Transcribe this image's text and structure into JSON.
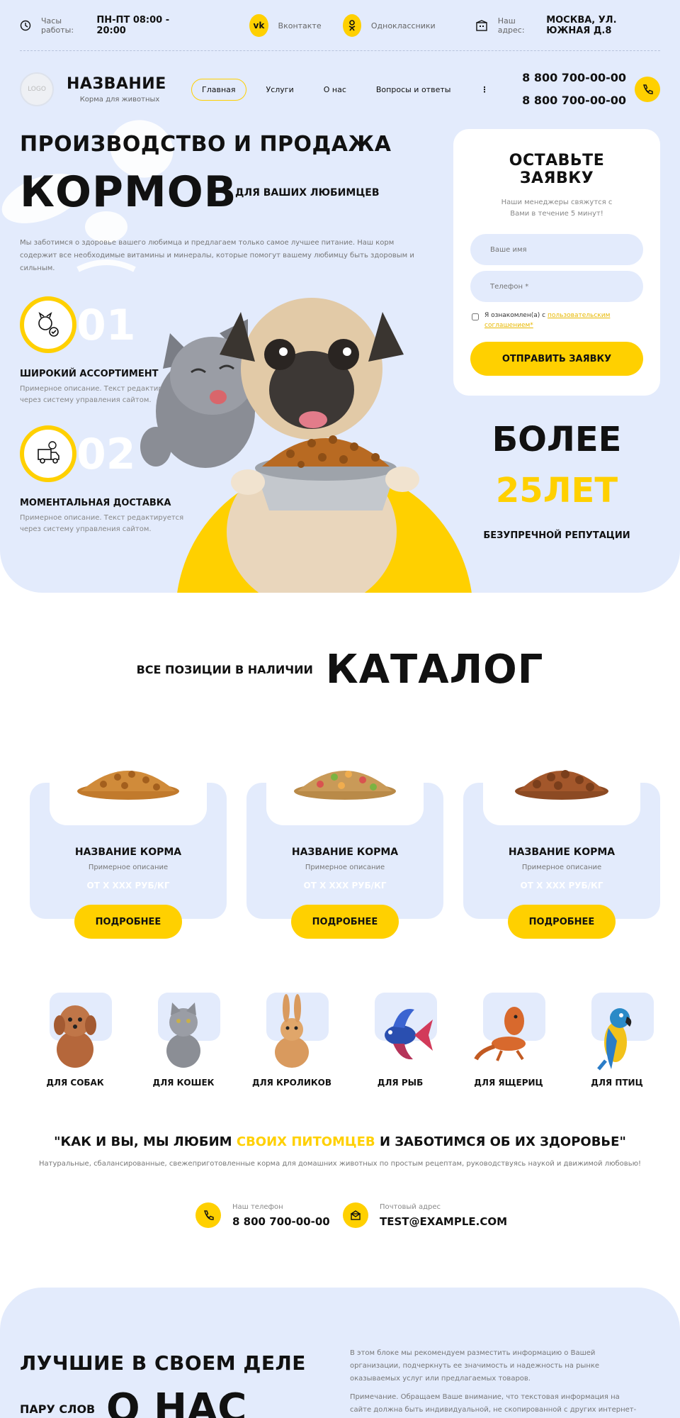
{
  "topbar": {
    "hours_label": "Часы работы:",
    "hours_value": "ПН-ПТ 08:00 - 20:00",
    "vk_icon": "vk",
    "vk_label": "Вконтакте",
    "ok_label": "Одноклассники",
    "address_label": "Наш адрес:",
    "address_value": "МОСКВА, УЛ. ЮЖНАЯ Д.8"
  },
  "header": {
    "logo_text": "LOGO",
    "brand_title": "НАЗВАНИЕ",
    "brand_subtitle": "Корма для животных",
    "nav": [
      "Главная",
      "Услуги",
      "О нас",
      "Вопросы и ответы"
    ],
    "more_icon": "⋮",
    "phone_1": "8 800 700-00-00",
    "phone_2": "8 800 700-00-00"
  },
  "hero": {
    "line1": "ПРОИЗВОДСТВО И ПРОДАЖА",
    "line2": "КОРМОВ",
    "line2_suffix": "ДЛЯ ВАШИХ ЛЮБИМЦЕВ",
    "description": "Мы заботимся о здоровье вашего любимца и предлагаем только самое лучшее питание. Наш корм содержит все необходимые витамины и минералы, которые помогут вашему любимцу быть здоровым и сильным.",
    "features": [
      {
        "num": "01",
        "title": "ШИРОКИЙ АССОРТИМЕНТ",
        "desc": "Примерное описание. Текст редактируется через систему управления сайтом."
      },
      {
        "num": "02",
        "title": "МОМЕНТАЛЬНАЯ ДОСТАВКА",
        "desc": "Примерное описание. Текст редактируется через систему управления сайтом."
      }
    ],
    "years_a": "БОЛЕЕ",
    "years_b": "25ЛЕТ",
    "years_c": "БЕЗУПРЕЧНОЙ РЕПУТАЦИИ"
  },
  "form": {
    "title": "ОСТАВЬТЕ ЗАЯВКУ",
    "subtitle": "Наши менеджеры свяжутся с Вами в течение 5 минут!",
    "name_placeholder": "Ваше имя",
    "phone_placeholder": "Телефон *",
    "consent_text": "Я ознакомлен(а) с",
    "consent_link": "пользовательским соглашением*",
    "submit": "ОТПРАВИТЬ ЗАЯВКУ"
  },
  "catalog": {
    "subtitle": "ВСЕ ПОЗИЦИИ В НАЛИЧИИ",
    "title": "КАТАЛОГ",
    "cards": [
      {
        "title": "НАЗВАНИЕ КОРМА",
        "desc": "Примерное описание",
        "price": "ОТ Х ХХХ РУБ/КГ",
        "button": "ПОДРОБНЕЕ"
      },
      {
        "title": "НАЗВАНИЕ КОРМА",
        "desc": "Примерное описание",
        "price": "ОТ Х ХХХ РУБ/КГ",
        "button": "ПОДРОБНЕЕ"
      },
      {
        "title": "НАЗВАНИЕ КОРМА",
        "desc": "Примерное описание",
        "price": "ОТ Х ХХХ РУБ/КГ",
        "button": "ПОДРОБНЕЕ"
      }
    ]
  },
  "categories": [
    "ДЛЯ СОБАК",
    "ДЛЯ КОШЕК",
    "ДЛЯ КРОЛИКОВ",
    "ДЛЯ РЫБ",
    "ДЛЯ ЯЩЕРИЦ",
    "ДЛЯ ПТИЦ"
  ],
  "quote": {
    "part1": "\"КАК И ВЫ, МЫ ЛЮБИМ",
    "highlight": "СВОИХ ПИТОМЦЕВ",
    "part2": "И ЗАБОТИМСЯ ОБ ИХ ЗДОРОВЬЕ\"",
    "subtitle": "Натуральные, сбалансированные, свежеприготовленные корма для домашних животных по простым рецептам, руководствуясь наукой и движимой любовью!"
  },
  "contacts": {
    "phone_label": "Наш телефон",
    "phone_value": "8 800 700-00-00",
    "email_label": "Почтовый адрес",
    "email_value": "TEST@EXAMPLE.COM"
  },
  "about": {
    "heading": "ЛУЧШИЕ В СВОЕМ ДЕЛЕ",
    "sub": "ПАРУ СЛОВ",
    "big": "О НАС",
    "p1": "В этом блоке мы рекомендуем разместить информацию о Вашей организации, подчеркнуть ее значимость и надежность на рынке оказываемых услуг или предлагаемых товаров.",
    "p2": "Примечание. Обращаем Ваше внимание, что текстовая информация на сайте должна быть индивидуальной, не скопированной с других интернет-ресурсов, о чем указано в"
  },
  "colors": {
    "accent": "#ffd000",
    "hero_bg": "#e3ebfc",
    "text": "#111111"
  }
}
